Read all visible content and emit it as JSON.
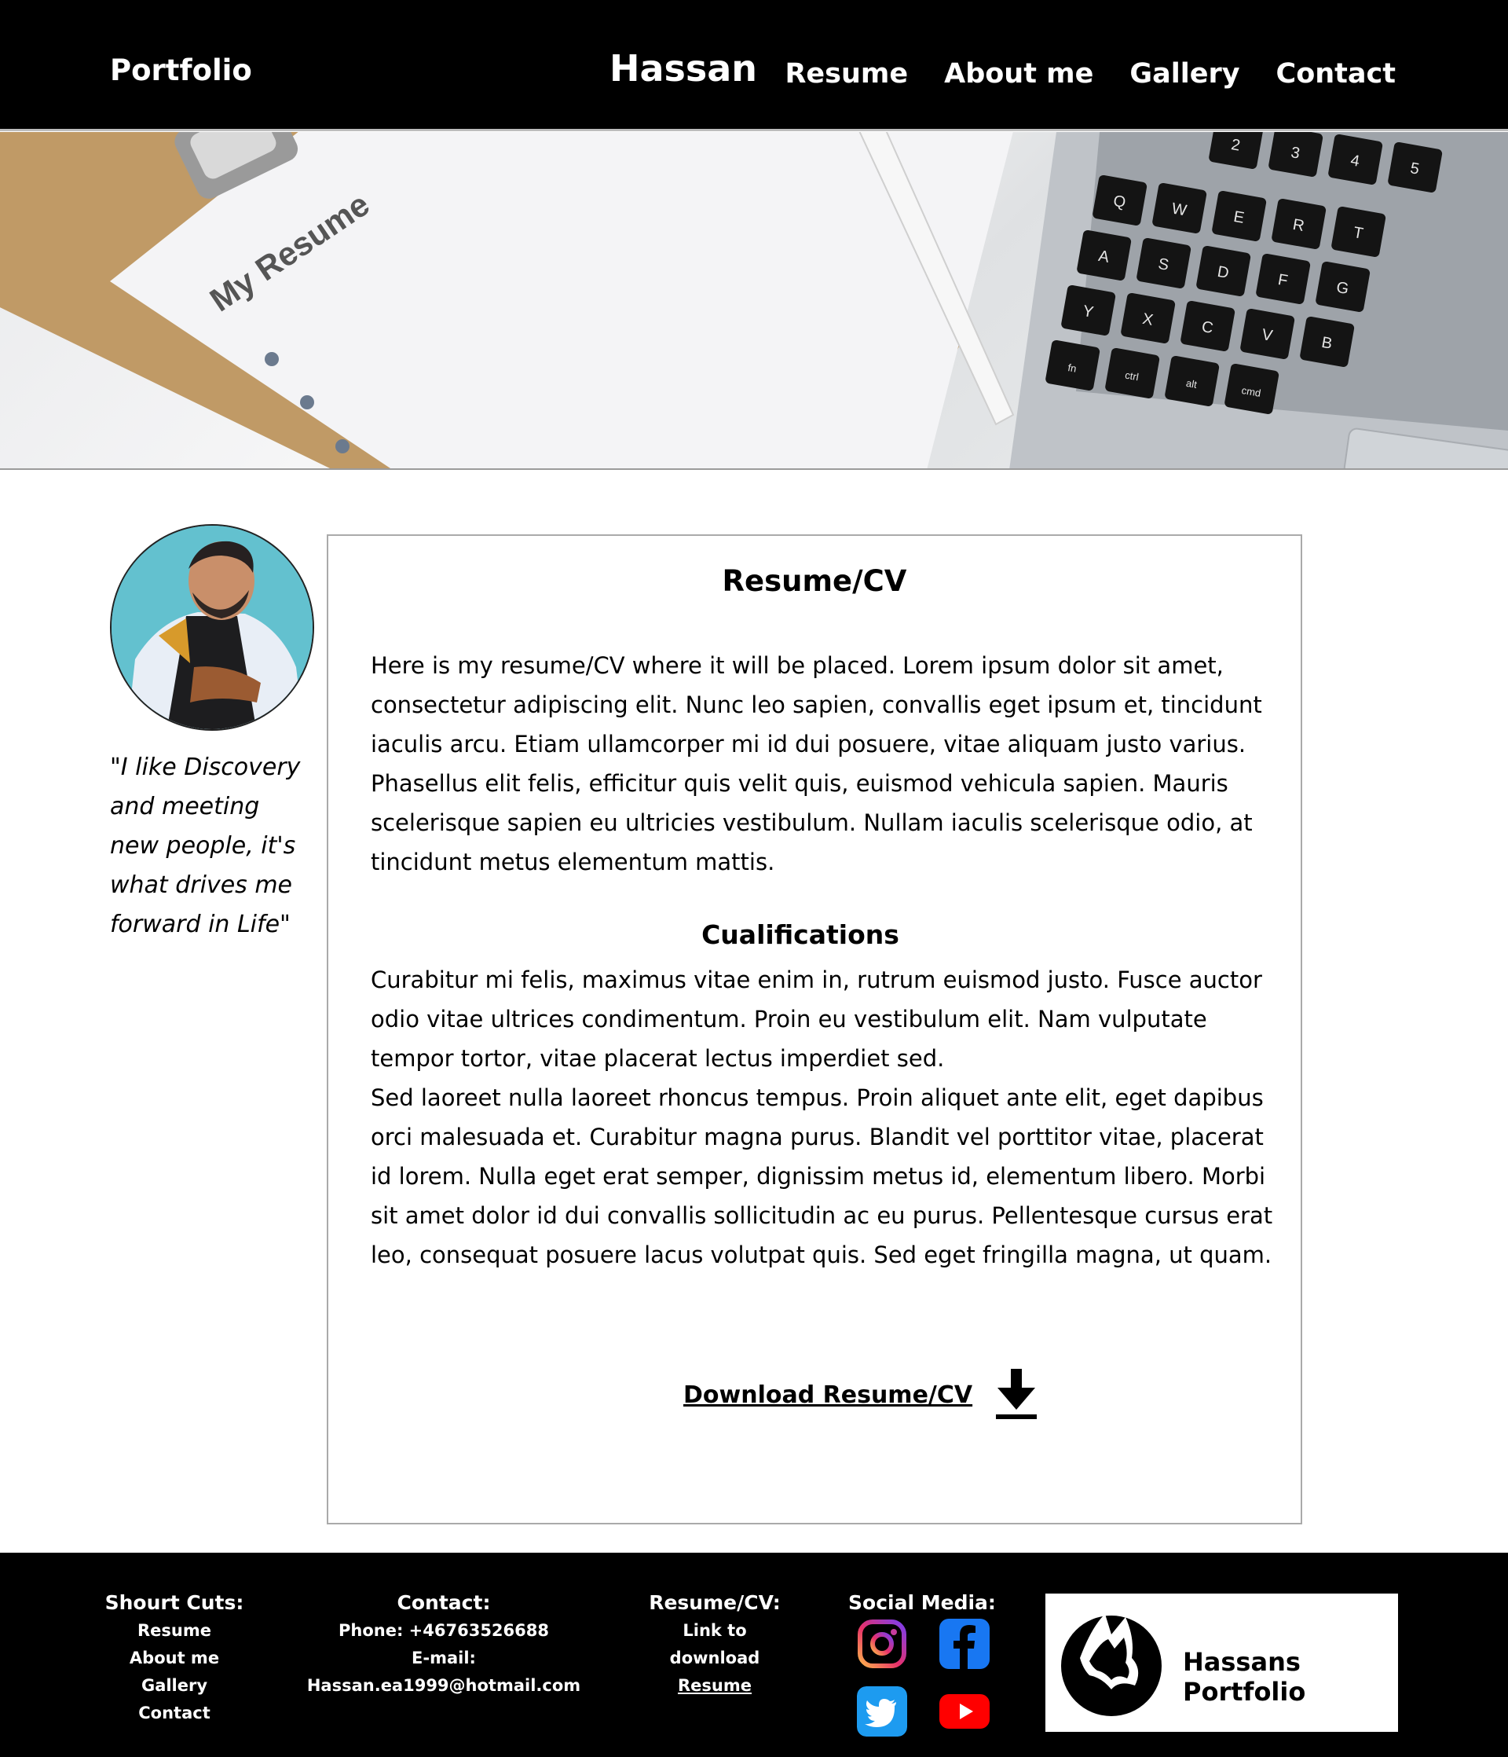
{
  "header": {
    "brand": "Portfolio",
    "site_name": "Hassan",
    "nav": [
      "Resume",
      "About me",
      "Gallery",
      "Contact"
    ]
  },
  "hero": {
    "paper_text": "My Resume",
    "keyboard_keys": [
      "2",
      "3",
      "4",
      "5",
      "Q",
      "W",
      "E",
      "R",
      "T",
      "A",
      "S",
      "D",
      "F",
      "G",
      "Y",
      "X",
      "C",
      "V",
      "B",
      "fn",
      "ctrl",
      "alt",
      "cmd"
    ]
  },
  "profile": {
    "quote": "\"I like Discovery and meeting new people, it's what drives me forward in Life\""
  },
  "resume": {
    "title": "Resume/CV",
    "intro": "Here is my resume/CV where it will be placed. Lorem ipsum dolor sit amet, consectetur adipiscing elit. Nunc leo sapien, convallis eget ipsum et, tincidunt iaculis arcu. Etiam ullamcorper mi id dui posuere, vitae aliquam justo varius. Phasellus elit felis, efficitur quis velit quis, euismod vehicula sapien. Mauris scelerisque sapien eu ultricies vestibulum. Nullam iaculis scelerisque odio, at tincidunt metus elementum mattis.",
    "qualifications_title": "Cualifications",
    "qualifications_p1": "Curabitur mi felis, maximus vitae enim in, rutrum euismod justo. Fusce auctor odio vitae ultrices condimentum. Proin eu vestibulum elit. Nam vulputate tempor tortor, vitae placerat lectus imperdiet sed.",
    "qualifications_p2": "Sed laoreet nulla laoreet rhoncus tempus. Proin aliquet ante elit, eget dapibus orci malesuada et. Curabitur magna purus. Blandit vel porttitor vitae, placerat id lorem. Nulla eget erat semper, dignissim metus id, elementum libero. Morbi sit amet dolor id dui convallis sollicitudin ac eu purus. Pellentesque cursus erat leo, consequat posuere lacus volutpat quis. Sed eget fringilla magna, ut quam.",
    "download_label": "Download Resume/CV",
    "download_icon": "download-icon"
  },
  "footer": {
    "shortcuts_title": "Shourt Cuts:",
    "shortcuts": [
      "Resume",
      "About me",
      "Gallery",
      "Contact"
    ],
    "contact_title": "Contact:",
    "phone": "Phone: +46763526688",
    "email": "E-mail: Hassan.ea1999@hotmail.com",
    "resume_title": "Resume/CV:",
    "resume_line1": "Link to",
    "resume_line2": "download",
    "resume_link": "Resume",
    "social_title": "Social Media:",
    "social_icons": [
      "instagram-icon",
      "facebook-icon",
      "twitter-icon",
      "youtube-icon"
    ],
    "logo_text": "Hassans Portfolio"
  }
}
